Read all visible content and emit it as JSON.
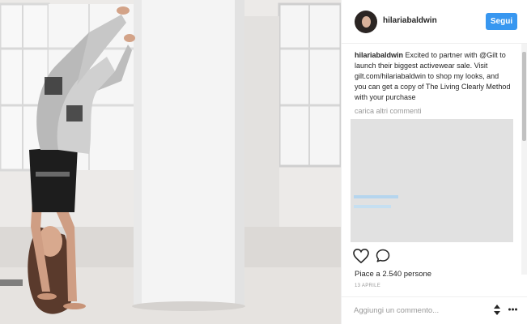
{
  "post": {
    "username": "hilariabaldwin",
    "follow_label": "Segui",
    "caption_user": "hilariabaldwin",
    "caption_text": "Excited to partner with @Gilt to launch their biggest activewear sale. Visit gilt.com/hilariabaldwin to shop my looks, and you can get a copy of The Living Clearly Method with your purchase",
    "load_more": "carica altri commenti",
    "likes_text": "Piace a 2.540 persone",
    "date": "13 APRILE",
    "comment_placeholder": "Aggiungi un commento..."
  },
  "icons": {
    "like": "heart-icon",
    "comment": "comment-icon",
    "stepper": "stepper-icon",
    "options": "more-options-icon"
  },
  "colors": {
    "accent": "#3897f0",
    "text": "#262626",
    "muted": "#999999"
  }
}
